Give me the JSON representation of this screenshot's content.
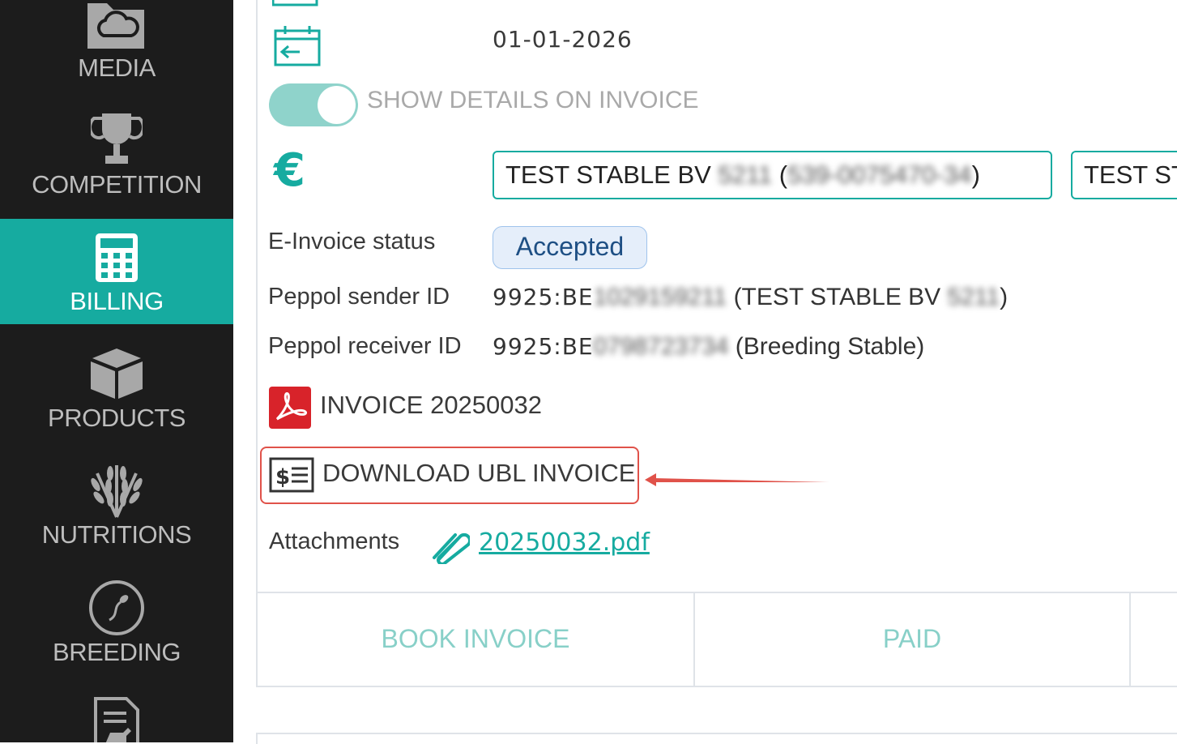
{
  "sidebar": {
    "items": [
      {
        "label": "MEDIA",
        "icon": "folder-cloud-icon"
      },
      {
        "label": "COMPETITION",
        "icon": "trophy-icon"
      },
      {
        "label": "BILLING",
        "icon": "calculator-icon",
        "active": true
      },
      {
        "label": "PRODUCTS",
        "icon": "box-icon"
      },
      {
        "label": "NUTRITIONS",
        "icon": "wheat-icon"
      },
      {
        "label": "BREEDING",
        "icon": "sperm-icon"
      },
      {
        "label": "",
        "icon": "horse-document-icon"
      }
    ]
  },
  "invoice": {
    "date": "01-01-2026",
    "show_details_label": "SHOW DETAILS ON INVOICE",
    "show_details_on": true,
    "currency_symbol": "€",
    "sender_box": {
      "name": "TEST STABLE BV",
      "blurred_num": "5211",
      "open": "(",
      "blurred_vat": "539-0075470-34",
      "close": ")"
    },
    "receiver_box": {
      "name": "TEST ST"
    },
    "einvoice_status_label": "E-Invoice status",
    "einvoice_status": "Accepted",
    "peppol_sender_label": "Peppol sender ID",
    "peppol_sender_prefix": "9925:BE",
    "peppol_sender_blurred": "1029159211",
    "peppol_sender_suffix": "(TEST STABLE BV",
    "peppol_sender_suffix_blurred": "5211",
    "peppol_sender_close": ")",
    "peppol_receiver_label": "Peppol receiver ID",
    "peppol_receiver_prefix": "9925:BE",
    "peppol_receiver_blurred": "0798723734",
    "peppol_receiver_suffix": "(Breeding Stable)",
    "pdf_label": "INVOICE 20250032",
    "ubl_label": "DOWNLOAD UBL INVOICE",
    "attachments_label": "Attachments",
    "attachment_file": "20250032.pdf"
  },
  "actions": {
    "book_invoice": "BOOK INVOICE",
    "paid": "PAID"
  },
  "colors": {
    "accent": "#16aba0",
    "sidebar_bg": "#1c1c1c",
    "highlight": "#e0524a",
    "pdf_red": "#d8232a"
  }
}
